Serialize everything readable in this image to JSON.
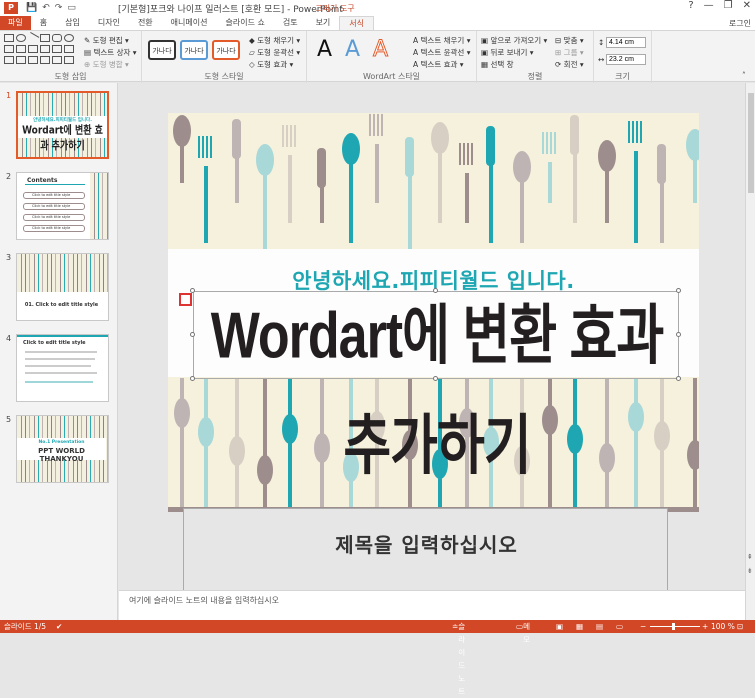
{
  "window": {
    "title": "[기본형]포크와 나이프 일러스트 [호환 모드] - PowerPoint",
    "context_tab_group": "그리기 도구",
    "app_icon": "P",
    "controls": [
      "?",
      "—",
      "❐",
      "✕"
    ]
  },
  "tabs": [
    {
      "label": "파일",
      "kind": "file"
    },
    {
      "label": "홈",
      "kind": "normal"
    },
    {
      "label": "삽입",
      "kind": "normal"
    },
    {
      "label": "디자인",
      "kind": "normal"
    },
    {
      "label": "전환",
      "kind": "normal"
    },
    {
      "label": "애니메이션",
      "kind": "normal"
    },
    {
      "label": "슬라이드 쇼",
      "kind": "normal"
    },
    {
      "label": "검토",
      "kind": "normal"
    },
    {
      "label": "보기",
      "kind": "normal"
    },
    {
      "label": "서식",
      "kind": "active"
    }
  ],
  "login": "로그인",
  "ribbon": {
    "insert_shapes": {
      "label": "도형 삽입",
      "edit_shape": "도형 편집",
      "text_box": "텍스트 상자",
      "merge_shapes": "도형 병합"
    },
    "shape_styles": {
      "label": "도형 스타일",
      "swatch_text": "가나다",
      "fill": "도형 채우기",
      "outline": "도형 윤곽선",
      "effects": "도형 효과"
    },
    "wordart_styles": {
      "label": "WordArt 스타일",
      "letter": "A",
      "text_fill": "텍스트 채우기",
      "text_outline": "텍스트 윤곽선",
      "text_effects": "텍스트 효과"
    },
    "arrange": {
      "label": "정렬",
      "bring_forward": "앞으로 가져오기",
      "send_backward": "뒤로 보내기",
      "selection_pane": "선택 창",
      "align": "맞춤",
      "group": "그룹",
      "rotate": "회전"
    },
    "size": {
      "label": "크기",
      "height": "4.14 cm",
      "width": "23.2 cm"
    }
  },
  "thumbnails": [
    {
      "num": "1",
      "line1": "안녕하세요.피피티월드 입니다.",
      "line2": "Wordart에 변환 효과 추가하기"
    },
    {
      "num": "2",
      "title": "Contents",
      "items": [
        "Click to edit title style",
        "Click to edit title style",
        "Click to edit title style",
        "Click to edit title style"
      ]
    },
    {
      "num": "3",
      "title": "01. Click to edit title style"
    },
    {
      "num": "4",
      "title": "Click to edit title style"
    },
    {
      "num": "5",
      "line1": "No.1 Presentation",
      "line2": "PPT WORLD THANKYOU"
    }
  ],
  "slide": {
    "subtitle": "안녕하세요.피피티월드 입니다.",
    "wordart": "Wordart에 변환 효과 추가하기",
    "title_placeholder": "제목을 입력하십시오"
  },
  "notes": {
    "placeholder": "여기에 슬라이드 노트의 내용을 입력하십시오"
  },
  "status": {
    "slide_count": "슬라이드 1/5",
    "notes_btn": "슬라이드 노트",
    "comments_btn": "메모",
    "zoom": "100 %"
  },
  "colors": {
    "accent": "#d24726",
    "teal": "#1ea7b2",
    "mauve": "#9e8d8d",
    "cream": "#f5f1dc"
  }
}
